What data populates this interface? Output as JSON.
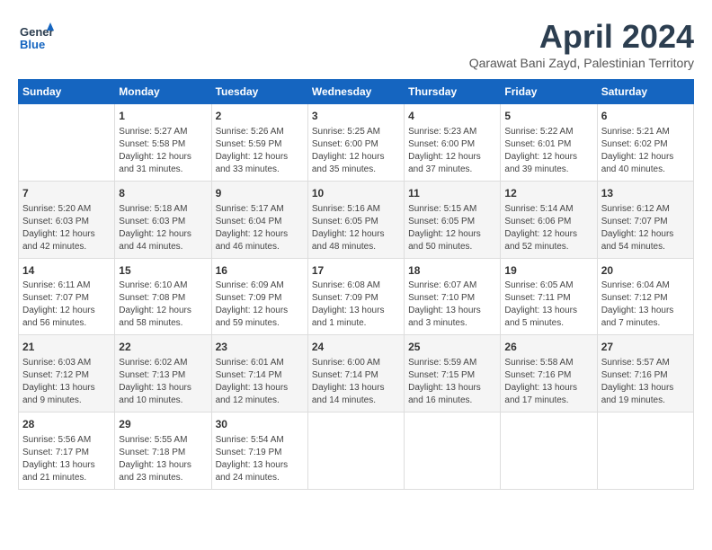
{
  "logo": {
    "general": "General",
    "blue": "Blue"
  },
  "title": "April 2024",
  "location": "Qarawat Bani Zayd, Palestinian Territory",
  "columns": [
    "Sunday",
    "Monday",
    "Tuesday",
    "Wednesday",
    "Thursday",
    "Friday",
    "Saturday"
  ],
  "weeks": [
    [
      {
        "day": "",
        "info": ""
      },
      {
        "day": "1",
        "info": "Sunrise: 5:27 AM\nSunset: 5:58 PM\nDaylight: 12 hours\nand 31 minutes."
      },
      {
        "day": "2",
        "info": "Sunrise: 5:26 AM\nSunset: 5:59 PM\nDaylight: 12 hours\nand 33 minutes."
      },
      {
        "day": "3",
        "info": "Sunrise: 5:25 AM\nSunset: 6:00 PM\nDaylight: 12 hours\nand 35 minutes."
      },
      {
        "day": "4",
        "info": "Sunrise: 5:23 AM\nSunset: 6:00 PM\nDaylight: 12 hours\nand 37 minutes."
      },
      {
        "day": "5",
        "info": "Sunrise: 5:22 AM\nSunset: 6:01 PM\nDaylight: 12 hours\nand 39 minutes."
      },
      {
        "day": "6",
        "info": "Sunrise: 5:21 AM\nSunset: 6:02 PM\nDaylight: 12 hours\nand 40 minutes."
      }
    ],
    [
      {
        "day": "7",
        "info": "Sunrise: 5:20 AM\nSunset: 6:03 PM\nDaylight: 12 hours\nand 42 minutes."
      },
      {
        "day": "8",
        "info": "Sunrise: 5:18 AM\nSunset: 6:03 PM\nDaylight: 12 hours\nand 44 minutes."
      },
      {
        "day": "9",
        "info": "Sunrise: 5:17 AM\nSunset: 6:04 PM\nDaylight: 12 hours\nand 46 minutes."
      },
      {
        "day": "10",
        "info": "Sunrise: 5:16 AM\nSunset: 6:05 PM\nDaylight: 12 hours\nand 48 minutes."
      },
      {
        "day": "11",
        "info": "Sunrise: 5:15 AM\nSunset: 6:05 PM\nDaylight: 12 hours\nand 50 minutes."
      },
      {
        "day": "12",
        "info": "Sunrise: 5:14 AM\nSunset: 6:06 PM\nDaylight: 12 hours\nand 52 minutes."
      },
      {
        "day": "13",
        "info": "Sunrise: 6:12 AM\nSunset: 7:07 PM\nDaylight: 12 hours\nand 54 minutes."
      }
    ],
    [
      {
        "day": "14",
        "info": "Sunrise: 6:11 AM\nSunset: 7:07 PM\nDaylight: 12 hours\nand 56 minutes."
      },
      {
        "day": "15",
        "info": "Sunrise: 6:10 AM\nSunset: 7:08 PM\nDaylight: 12 hours\nand 58 minutes."
      },
      {
        "day": "16",
        "info": "Sunrise: 6:09 AM\nSunset: 7:09 PM\nDaylight: 12 hours\nand 59 minutes."
      },
      {
        "day": "17",
        "info": "Sunrise: 6:08 AM\nSunset: 7:09 PM\nDaylight: 13 hours\nand 1 minute."
      },
      {
        "day": "18",
        "info": "Sunrise: 6:07 AM\nSunset: 7:10 PM\nDaylight: 13 hours\nand 3 minutes."
      },
      {
        "day": "19",
        "info": "Sunrise: 6:05 AM\nSunset: 7:11 PM\nDaylight: 13 hours\nand 5 minutes."
      },
      {
        "day": "20",
        "info": "Sunrise: 6:04 AM\nSunset: 7:12 PM\nDaylight: 13 hours\nand 7 minutes."
      }
    ],
    [
      {
        "day": "21",
        "info": "Sunrise: 6:03 AM\nSunset: 7:12 PM\nDaylight: 13 hours\nand 9 minutes."
      },
      {
        "day": "22",
        "info": "Sunrise: 6:02 AM\nSunset: 7:13 PM\nDaylight: 13 hours\nand 10 minutes."
      },
      {
        "day": "23",
        "info": "Sunrise: 6:01 AM\nSunset: 7:14 PM\nDaylight: 13 hours\nand 12 minutes."
      },
      {
        "day": "24",
        "info": "Sunrise: 6:00 AM\nSunset: 7:14 PM\nDaylight: 13 hours\nand 14 minutes."
      },
      {
        "day": "25",
        "info": "Sunrise: 5:59 AM\nSunset: 7:15 PM\nDaylight: 13 hours\nand 16 minutes."
      },
      {
        "day": "26",
        "info": "Sunrise: 5:58 AM\nSunset: 7:16 PM\nDaylight: 13 hours\nand 17 minutes."
      },
      {
        "day": "27",
        "info": "Sunrise: 5:57 AM\nSunset: 7:16 PM\nDaylight: 13 hours\nand 19 minutes."
      }
    ],
    [
      {
        "day": "28",
        "info": "Sunrise: 5:56 AM\nSunset: 7:17 PM\nDaylight: 13 hours\nand 21 minutes."
      },
      {
        "day": "29",
        "info": "Sunrise: 5:55 AM\nSunset: 7:18 PM\nDaylight: 13 hours\nand 23 minutes."
      },
      {
        "day": "30",
        "info": "Sunrise: 5:54 AM\nSunset: 7:19 PM\nDaylight: 13 hours\nand 24 minutes."
      },
      {
        "day": "",
        "info": ""
      },
      {
        "day": "",
        "info": ""
      },
      {
        "day": "",
        "info": ""
      },
      {
        "day": "",
        "info": ""
      }
    ]
  ]
}
